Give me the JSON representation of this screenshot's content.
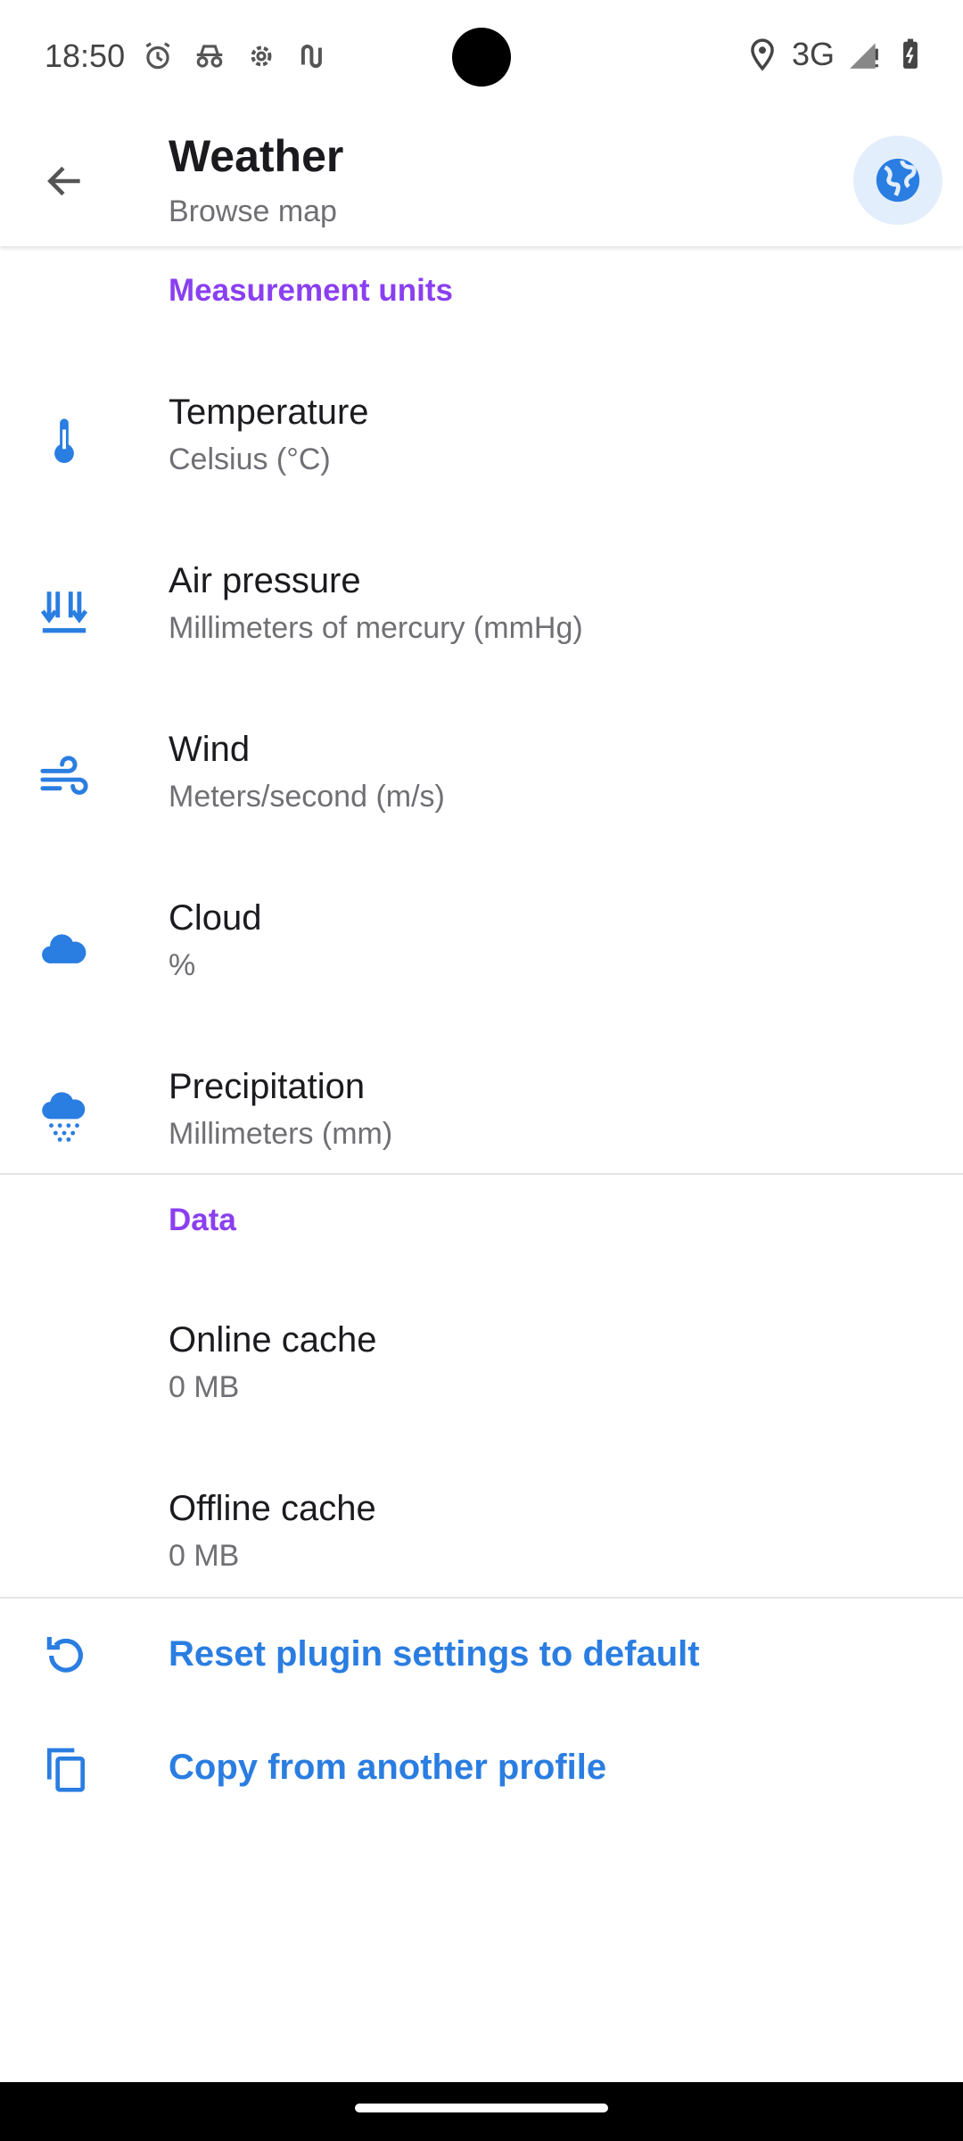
{
  "status_bar": {
    "time": "18:50",
    "network": "3G"
  },
  "app_bar": {
    "title": "Weather",
    "subtitle": "Browse map"
  },
  "sections": {
    "units_header": "Measurement units",
    "data_header": "Data"
  },
  "units": [
    {
      "title": "Temperature",
      "value": "Celsius (°C)",
      "icon": "thermometer-icon"
    },
    {
      "title": "Air pressure",
      "value": "Millimeters of mercury (mmHg)",
      "icon": "air-pressure-icon"
    },
    {
      "title": "Wind",
      "value": "Meters/second (m/s)",
      "icon": "wind-icon"
    },
    {
      "title": "Cloud",
      "value": "%",
      "icon": "cloud-icon"
    },
    {
      "title": "Precipitation",
      "value": "Millimeters (mm)",
      "icon": "precipitation-icon"
    }
  ],
  "data_items": [
    {
      "title": "Online cache",
      "value": "0 MB"
    },
    {
      "title": "Offline cache",
      "value": "0 MB"
    }
  ],
  "actions": {
    "reset_label": "Reset plugin settings to default",
    "copy_label": "Copy from another profile"
  },
  "colors": {
    "accent": "#2a7de1",
    "section": "#8a3ff0"
  }
}
